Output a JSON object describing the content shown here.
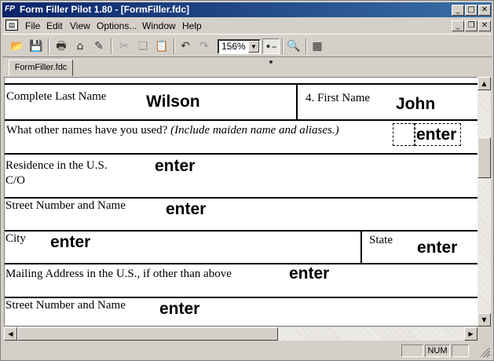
{
  "window": {
    "title": "Form Filler Pilot 1.80 - [FormFiller.fdc]",
    "app_icon": "FP"
  },
  "menu": {
    "items": [
      "File",
      "Edit",
      "View",
      "Options...",
      "Window",
      "Help"
    ]
  },
  "toolbar": {
    "zoom_value": "156%",
    "icons": [
      "open-icon",
      "save-icon",
      "print-icon",
      "print-preview-icon",
      "scanner-icon",
      "cut-icon",
      "copy-icon",
      "paste-icon",
      "undo-icon",
      "redo-icon",
      "zoom-dropdown",
      "field-link-icon",
      "search-icon",
      "grid-icon"
    ]
  },
  "tabs": [
    {
      "label": "FormFiller.fdc"
    }
  ],
  "form": {
    "rows": [
      {
        "label": "Complete Last Name",
        "value": "Wilson"
      },
      {
        "label": "4.  First Name",
        "value": "John"
      },
      {
        "label": "What other names have you used? ",
        "label_italic": "(Include maiden name and aliases.)",
        "value": "enter"
      },
      {
        "label": "Residence in the U.S.",
        "label2": "C/O",
        "value": "enter"
      },
      {
        "label": "Street Number and Name",
        "value": "enter"
      },
      {
        "label": "City",
        "value": "enter"
      },
      {
        "label": "State",
        "value": "enter"
      },
      {
        "label": "Mailing Address in the U.S., if other than above",
        "value": "enter"
      },
      {
        "label": "Street Number and Name",
        "value": "enter"
      }
    ]
  },
  "statusbar": {
    "num": "NUM"
  },
  "colors": {
    "titlebar_start": "#0a246a",
    "titlebar_end": "#3a6ea5",
    "chrome": "#d4d0c8"
  }
}
